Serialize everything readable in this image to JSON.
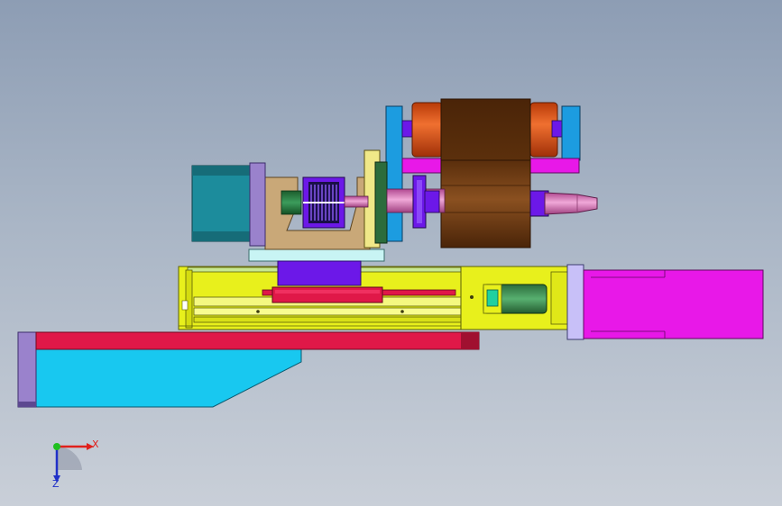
{
  "viewport": {
    "background_top": "#8d9db4",
    "background_bottom": "#c9cfd8"
  },
  "triad": {
    "x_label": "X",
    "z_label": "Z",
    "x_color": "#e0201c",
    "z_color": "#2030c8",
    "origin_color": "#20c020"
  },
  "parts": [
    "motor-block-left",
    "belt-pulley",
    "motor-bracket",
    "spindle-housing",
    "spindle-nose",
    "upper-motor",
    "linear-stage",
    "stage-slider",
    "servo-motor-right",
    "base-rail",
    "base-bracket"
  ],
  "colors": {
    "teal": "#1c8c9c",
    "lavender": "#9a82cc",
    "tan": "#c9a878",
    "brown": "#7a4416",
    "orange": "#e0561c",
    "magenta": "#e818e8",
    "yellow": "#e8f01c",
    "red": "#e01848",
    "cyan": "#18c8f0",
    "violet": "#6c18e8",
    "pink": "#d878b8"
  }
}
